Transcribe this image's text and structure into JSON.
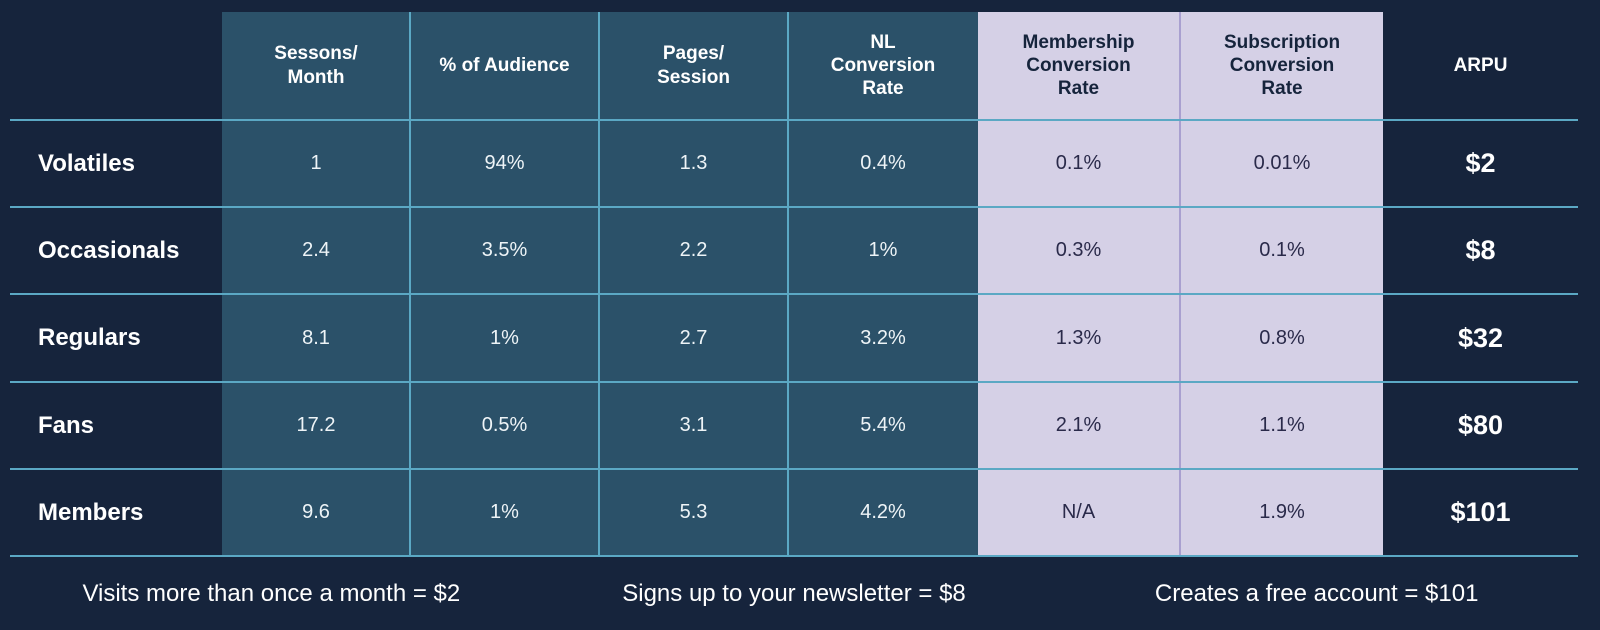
{
  "theme": {
    "background": "#16243c",
    "teal_band": "#2b5169",
    "lavender_band": "#d5d0e6",
    "divider_teal": "#5ba8c4",
    "divider_lavender": "#a9a0d0",
    "text_light": "#ffffff",
    "text_dark": "#2a2a4a"
  },
  "table": {
    "columns": [
      {
        "key": "segment",
        "label": "",
        "style": "label"
      },
      {
        "key": "sessions",
        "label": "Sessons/\nMonth",
        "style": "teal"
      },
      {
        "key": "audience",
        "label": "% of Audience",
        "style": "teal"
      },
      {
        "key": "pages",
        "label": "Pages/\nSession",
        "style": "teal"
      },
      {
        "key": "nl",
        "label": "NL\nConversion\nRate",
        "style": "teal"
      },
      {
        "key": "member",
        "label": "Membership\nConversion\nRate",
        "style": "lav"
      },
      {
        "key": "subs",
        "label": "Subscription\nConversion\nRate",
        "style": "lav"
      },
      {
        "key": "arpu",
        "label": "ARPU",
        "style": "arpu"
      }
    ],
    "header_lines": {
      "sessions": [
        "Sessons/",
        "Month"
      ],
      "audience": [
        "% of Audience"
      ],
      "pages": [
        "Pages/",
        "Session"
      ],
      "nl": [
        "NL",
        "Conversion",
        "Rate"
      ],
      "member": [
        "Membership",
        "Conversion",
        "Rate"
      ],
      "subs": [
        "Subscription",
        "Conversion",
        "Rate"
      ],
      "arpu": [
        "ARPU"
      ]
    },
    "rows": [
      {
        "segment": "Volatiles",
        "sessions": "1",
        "audience": "94%",
        "pages": "1.3",
        "nl": "0.4%",
        "member": "0.1%",
        "subs": "0.01%",
        "arpu": "$2"
      },
      {
        "segment": "Occasionals",
        "sessions": "2.4",
        "audience": "3.5%",
        "pages": "2.2",
        "nl": "1%",
        "member": "0.3%",
        "subs": "0.1%",
        "arpu": "$8"
      },
      {
        "segment": "Regulars",
        "sessions": "8.1",
        "audience": "1%",
        "pages": "2.7",
        "nl": "3.2%",
        "member": "1.3%",
        "subs": "0.8%",
        "arpu": "$32"
      },
      {
        "segment": "Fans",
        "sessions": "17.2",
        "audience": "0.5%",
        "pages": "3.1",
        "nl": "5.4%",
        "member": "2.1%",
        "subs": "1.1%",
        "arpu": "$80"
      },
      {
        "segment": "Members",
        "sessions": "9.6",
        "audience": "1%",
        "pages": "5.3",
        "nl": "4.2%",
        "member": "N/A",
        "subs": "1.9%",
        "arpu": "$101"
      }
    ]
  },
  "footer": {
    "captions": [
      "Visits more than once a month = $2",
      "Signs up to your newsletter = $8",
      "Creates a free account = $101"
    ]
  },
  "chart_data": {
    "type": "table",
    "title": "",
    "categories": [
      "Volatiles",
      "Occasionals",
      "Regulars",
      "Fans",
      "Members"
    ],
    "columns": [
      "Sessons/Month",
      "% of Audience",
      "Pages/Session",
      "NL Conversion Rate",
      "Membership Conversion Rate",
      "Subscription Conversion Rate",
      "ARPU"
    ],
    "series": [
      {
        "name": "Sessons/Month",
        "values": [
          1,
          2.4,
          8.1,
          17.2,
          9.6
        ]
      },
      {
        "name": "% of Audience",
        "values": [
          94,
          3.5,
          1,
          0.5,
          1
        ]
      },
      {
        "name": "Pages/Session",
        "values": [
          1.3,
          2.2,
          2.7,
          3.1,
          5.3
        ]
      },
      {
        "name": "NL Conversion Rate",
        "values": [
          0.4,
          1,
          3.2,
          5.4,
          4.2
        ]
      },
      {
        "name": "Membership Conversion Rate",
        "values": [
          0.1,
          0.3,
          1.3,
          2.1,
          null
        ]
      },
      {
        "name": "Subscription Conversion Rate",
        "values": [
          0.01,
          0.1,
          0.8,
          1.1,
          1.9
        ]
      },
      {
        "name": "ARPU",
        "values": [
          2,
          8,
          32,
          80,
          101
        ]
      }
    ],
    "annotations": [
      "Visits more than once a month = $2",
      "Signs up to your newsletter = $8",
      "Creates a free account = $101"
    ]
  }
}
